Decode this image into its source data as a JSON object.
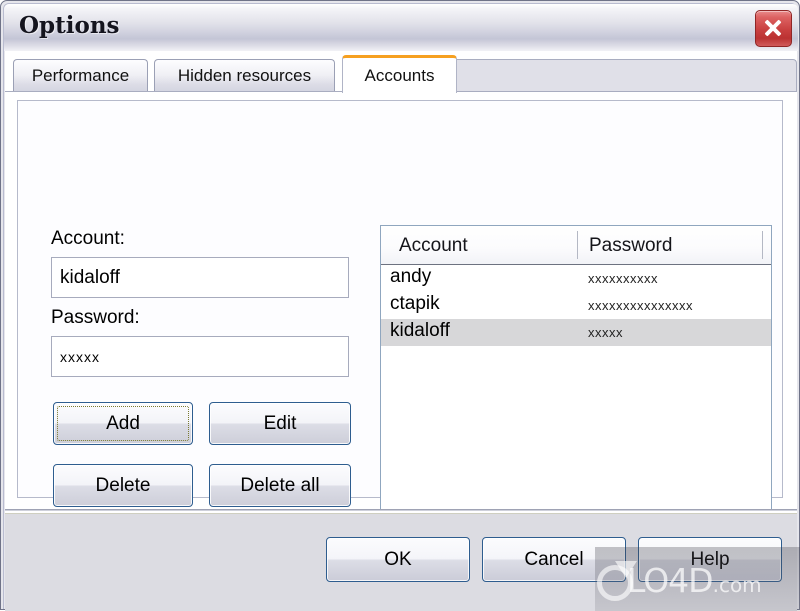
{
  "window": {
    "title": "Options",
    "close_icon": "close-icon"
  },
  "tabs": [
    {
      "label": "Performance",
      "active": false
    },
    {
      "label": "Hidden resources",
      "active": false
    },
    {
      "label": "Accounts",
      "active": true
    }
  ],
  "form": {
    "account_label": "Account:",
    "account_value": "kidaloff",
    "password_label": "Password:",
    "password_value": "xxxxx"
  },
  "action_buttons": {
    "add": "Add",
    "edit": "Edit",
    "delete": "Delete",
    "delete_all": "Delete all"
  },
  "list": {
    "columns": [
      "Account",
      "Password"
    ],
    "rows": [
      {
        "account": "andy",
        "password": "xxxxxxxxxx",
        "selected": false
      },
      {
        "account": "ctapik",
        "password": "xxxxxxxxxxxxxxx",
        "selected": false
      },
      {
        "account": "kidaloff",
        "password": "xxxxx",
        "selected": true
      }
    ]
  },
  "footer_buttons": {
    "ok": "OK",
    "cancel": "Cancel",
    "help": "Help"
  },
  "watermark": {
    "text": "LO4D",
    "suffix": ".com"
  },
  "colors": {
    "accent_tab": "#f6a020",
    "close_button": "#c83f3f",
    "button_border": "#2e5d8f",
    "selected_row": "#d7d7d9",
    "footer_bg": "#dcdce2"
  }
}
